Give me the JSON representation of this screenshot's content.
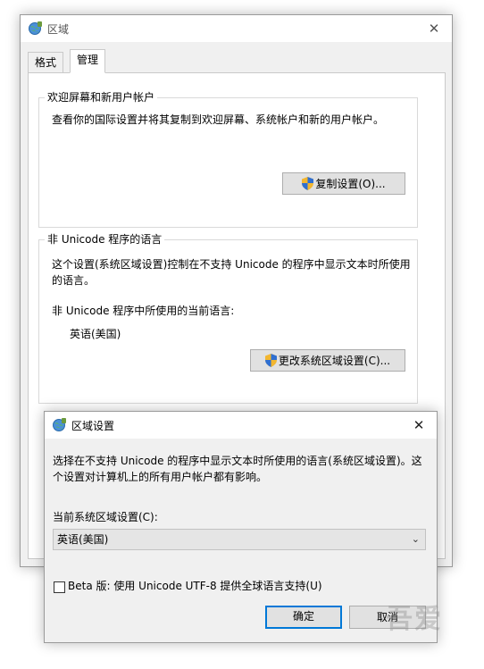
{
  "main_window": {
    "title": "区域",
    "close_glyph": "✕",
    "tabs": [
      {
        "label": "格式",
        "active": false
      },
      {
        "label": "管理",
        "active": true
      }
    ],
    "welcome_group": {
      "title": "欢迎屏幕和新用户帐户",
      "description": "查看你的国际设置并将其复制到欢迎屏幕、系统帐户和新的用户帐户。",
      "copy_button": "复制设置(O)..."
    },
    "non_unicode_group": {
      "title": "非 Unicode 程序的语言",
      "description": "这个设置(系统区域设置)控制在不支持 Unicode 的程序中显示文本时所使用的语言。",
      "current_label": "非 Unicode 程序中所使用的当前语言:",
      "current_value": "英语(美国)",
      "change_button": "更改系统区域设置(C)..."
    }
  },
  "dialog": {
    "title": "区域设置",
    "close_glyph": "✕",
    "description": "选择在不支持 Unicode 的程序中显示文本时所使用的语言(系统区域设置)。这个设置对计算机上的所有用户帐户都有影响。",
    "locale_label": "当前系统区域设置(C):",
    "locale_value": "英语(美国)",
    "beta_checkbox_label": "Beta 版: 使用 Unicode UTF-8 提供全球语言支持(U)",
    "beta_checked": false,
    "ok_button": "确定",
    "cancel_button": "取消"
  },
  "watermark_text": "吾爱"
}
